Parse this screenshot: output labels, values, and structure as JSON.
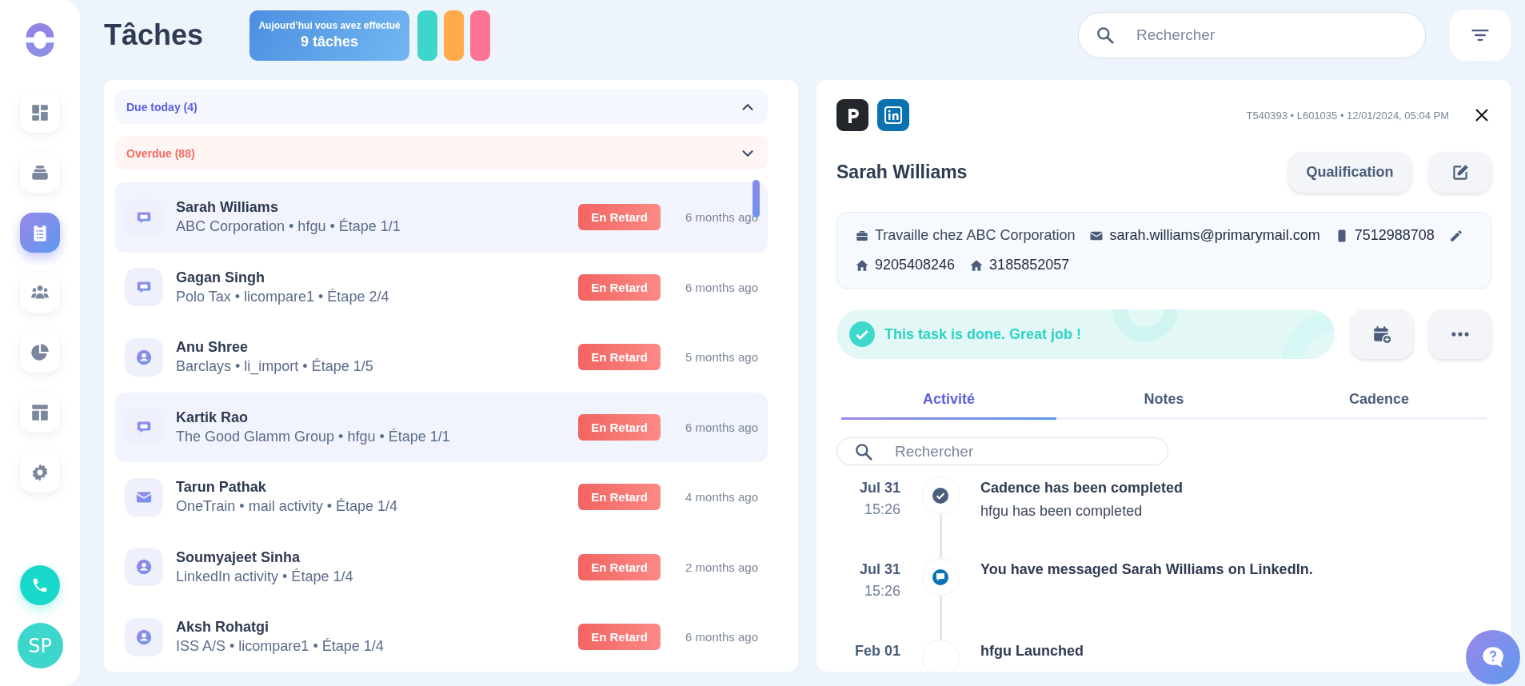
{
  "sidebar": {
    "nav": [
      {
        "kind": "dashboard",
        "selected": false
      },
      {
        "kind": "inbox",
        "selected": false
      },
      {
        "kind": "tasks",
        "selected": true
      },
      {
        "kind": "people",
        "selected": false
      },
      {
        "kind": "chart",
        "selected": false
      },
      {
        "kind": "layout",
        "selected": false
      },
      {
        "kind": "settings",
        "selected": false
      }
    ],
    "avatar": "SP"
  },
  "header": {
    "title": "Tâches",
    "summary": {
      "label": "Aujourd’hui vous avez effectué",
      "count": "9 tâches"
    },
    "color_bars": [
      {
        "color": "#3dd6cc"
      },
      {
        "color": "#ffab4a"
      },
      {
        "color": "#fb7493"
      }
    ],
    "search": {
      "placeholder": "Rechercher"
    }
  },
  "task_list": {
    "groups": [
      {
        "label": "Due today (4)",
        "kind": "today",
        "expanded": true
      },
      {
        "label": "Overdue (88)",
        "kind": "overdue",
        "expanded": false
      }
    ],
    "items": [
      {
        "kind": "chat",
        "name": "Sarah Williams",
        "details": "ABC Corporation • hfgu • Étape 1/1",
        "badge": "En Retard",
        "time": "6 months ago",
        "selected": true
      },
      {
        "kind": "chat",
        "name": "Gagan Singh",
        "details": "Polo Tax • licompare1 • Étape 2/4",
        "badge": "En Retard",
        "time": "6 months ago",
        "selected": false
      },
      {
        "kind": "person",
        "name": "Anu Shree",
        "details": "Barclays • li_import • Étape 1/5",
        "badge": "En Retard",
        "time": "5 months ago",
        "selected": false
      },
      {
        "kind": "chat",
        "name": "Kartik Rao",
        "details": "The Good Glamm Group • hfgu • Étape 1/1",
        "badge": "En Retard",
        "time": "6 months ago",
        "selected": true
      },
      {
        "kind": "mail",
        "name": "Tarun Pathak",
        "details": "OneTrain • mail activity • Étape 1/4",
        "badge": "En Retard",
        "time": "4 months ago",
        "selected": false
      },
      {
        "kind": "person",
        "name": "Soumyajeet Sinha",
        "details": "LinkedIn activity • Étape 1/4",
        "badge": "En Retard",
        "time": "2 months ago",
        "selected": false
      },
      {
        "kind": "person",
        "name": "Aksh Rohatgi",
        "details": "ISS A/S • licompare1 • Étape 1/4",
        "badge": "En Retard",
        "time": "6 months ago",
        "selected": false
      }
    ]
  },
  "detail": {
    "meta": "T540393 • L601035 • 12/01/2024, 05:04 PM",
    "name": "Sarah Williams",
    "qualification_button": "Qualification",
    "contact": [
      {
        "kind": "work",
        "text": "Travaille chez ABC Corporation"
      },
      {
        "kind": "email",
        "text": "sarah.williams@primarymail.com"
      },
      {
        "kind": "mobile",
        "text": "7512988708"
      },
      {
        "kind": "home",
        "text": "9205408246"
      },
      {
        "kind": "home",
        "text": "3185852057"
      }
    ],
    "status": "This task is done. Great job !",
    "tabs": [
      {
        "label": "Activité",
        "selected": true
      },
      {
        "label": "Notes",
        "selected": false
      },
      {
        "label": "Cadence",
        "selected": false
      }
    ],
    "search": {
      "placeholder": "Rechercher"
    },
    "timeline": [
      {
        "kind": "done",
        "date": "Jul 31",
        "time": "15:26",
        "title": "Cadence has been completed",
        "text": "hfgu has been completed"
      },
      {
        "kind": "linkedin",
        "date": "Jul 31",
        "time": "15:26",
        "title": "You have messaged Sarah Williams on LinkedIn."
      },
      {
        "kind": "launch",
        "date": "Feb 01",
        "title": "hfgu Launched"
      }
    ]
  }
}
